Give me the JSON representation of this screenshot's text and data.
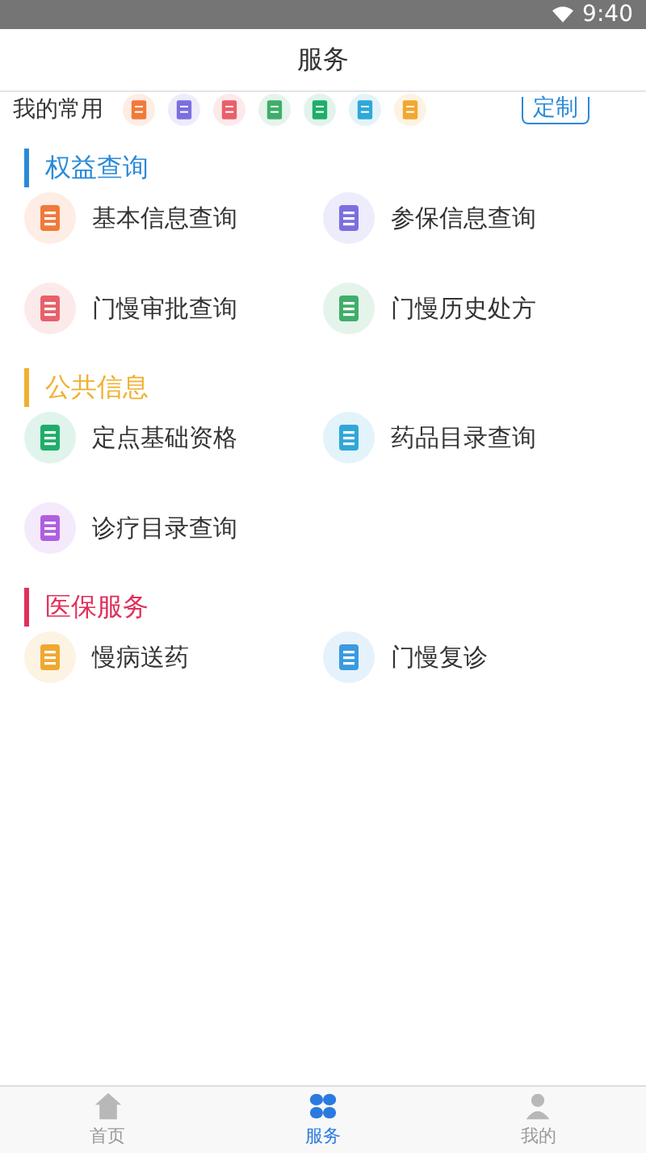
{
  "status_bar": {
    "time": "9:40"
  },
  "header": {
    "title": "服务"
  },
  "favorites": {
    "label": "我的常用",
    "icons": [
      {
        "color": "#f07a3a"
      },
      {
        "color": "#7b6fe0"
      },
      {
        "color": "#e8606a"
      },
      {
        "color": "#3fae6a"
      },
      {
        "color": "#1fae6a"
      },
      {
        "color": "#2fa8d8"
      },
      {
        "color": "#f0a830"
      }
    ],
    "button": "定制"
  },
  "sections": [
    {
      "title": "权益查询",
      "color": "#2a8ad8",
      "items": [
        {
          "label": "基本信息查询",
          "color": "#f07a3a"
        },
        {
          "label": "参保信息查询",
          "color": "#7b6fe0"
        },
        {
          "label": "门慢审批查询",
          "color": "#e8606a"
        },
        {
          "label": "门慢历史处方",
          "color": "#3fae6a"
        }
      ]
    },
    {
      "title": "公共信息",
      "color": "#f0b030",
      "items": [
        {
          "label": "定点基础资格",
          "color": "#1fae6a"
        },
        {
          "label": "药品目录查询",
          "color": "#2fa8d8"
        },
        {
          "label": "诊疗目录查询",
          "color": "#b05ee0"
        }
      ]
    },
    {
      "title": "医保服务",
      "color": "#e0305a",
      "items": [
        {
          "label": "慢病送药",
          "color": "#f0a830"
        },
        {
          "label": "门慢复诊",
          "color": "#3a9ae0"
        }
      ]
    }
  ],
  "tabs": [
    {
      "label": "首页",
      "selected": false
    },
    {
      "label": "服务",
      "selected": true
    },
    {
      "label": "我的",
      "selected": false
    }
  ]
}
